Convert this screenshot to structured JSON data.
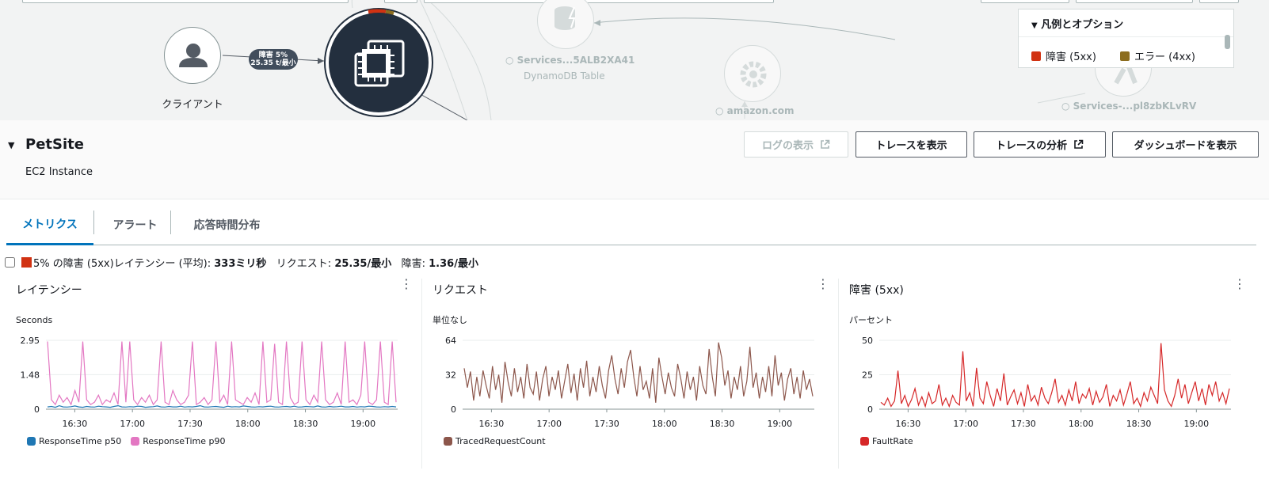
{
  "map": {
    "client_label": "クライアント",
    "edge_label_line1": "障害 5%",
    "edge_label_line2": "25.35 t/最小",
    "dynamo_name": "Services...5ALB2XA41",
    "dynamo_type": "DynamoDB Table",
    "amazon_name": "amazon.com",
    "lambda_name": "Services-...pl8zbKLvRV"
  },
  "legend": {
    "header": "凡例とオプション",
    "items": [
      {
        "label": "障害 (5xx)",
        "color": "#d13212"
      },
      {
        "label": "エラー (4xx)",
        "color": "#8c6d1f"
      }
    ]
  },
  "detail": {
    "title": "PetSite",
    "type": "EC2 Instance",
    "buttons": {
      "logs": "ログの表示",
      "traces": "トレースを表示",
      "analytics": "トレースの分析",
      "dashboard": "ダッシュボードを表示"
    }
  },
  "tabs": [
    "メトリクス",
    "アラート",
    "応答時間分布"
  ],
  "summary": {
    "fault_label": "5% の障害 (5xx)",
    "latency_label": "レイテンシー (平均):",
    "latency_value": "333ミリ秒",
    "requests_label": "リクエスト:",
    "requests_value": "25.35/最小",
    "faults_label": "障害:",
    "faults_value": "1.36/最小"
  },
  "colors": {
    "accent": "#0073bb",
    "fault": "#d13212",
    "error": "#8c6d1f",
    "p50": "#1f77b4",
    "p90": "#e377c2",
    "requests": "#8c564b",
    "faultrate": "#d62728"
  },
  "chart_data": [
    {
      "type": "line",
      "title": "レイテンシー",
      "ylabel": "Seconds",
      "yticks": [
        "2.95",
        "1.48",
        "0"
      ],
      "ylim": [
        0,
        2.95
      ],
      "xticks": [
        "16:30",
        "17:00",
        "17:30",
        "18:00",
        "18:30",
        "19:00"
      ],
      "xlim": [
        16.25,
        19.3
      ],
      "series": [
        {
          "name": "ResponseTime p50",
          "color": "#1f77b4",
          "values": [
            0.1,
            0.12,
            0.08,
            0.15,
            0.1,
            0.09,
            0.11,
            0.14,
            0.1,
            0.08,
            0.12,
            0.1,
            0.09,
            0.13,
            0.11,
            0.1,
            0.08,
            0.12,
            0.15,
            0.1,
            0.09,
            0.11,
            0.1,
            0.13,
            0.12,
            0.08,
            0.1,
            0.11,
            0.14,
            0.1,
            0.09,
            0.12,
            0.1,
            0.1,
            0.13,
            0.09,
            0.11,
            0.1,
            0.12,
            0.15,
            0.1,
            0.09,
            0.11,
            0.12,
            0.1,
            0.08,
            0.13,
            0.1,
            0.11,
            0.1,
            0.14,
            0.12,
            0.1,
            0.09,
            0.11,
            0.1,
            0.12,
            0.13,
            0.1,
            0.09,
            0.11,
            0.12,
            0.1,
            0.13,
            0.09,
            0.1,
            0.12,
            0.11,
            0.1,
            0.14,
            0.1,
            0.09,
            0.12,
            0.1,
            0.11,
            0.13,
            0.1,
            0.1,
            0.12,
            0.09,
            0.11,
            0.1,
            0.13,
            0.12,
            0.1,
            0.09,
            0.11,
            0.1,
            0.12,
            0.1
          ]
        },
        {
          "name": "ResponseTime p90",
          "color": "#e377c2",
          "values": [
            2.9,
            0.4,
            0.2,
            0.6,
            0.3,
            0.5,
            0.2,
            0.8,
            0.3,
            2.9,
            0.4,
            0.2,
            0.3,
            0.6,
            0.2,
            0.4,
            0.3,
            0.7,
            0.2,
            2.9,
            0.3,
            2.9,
            0.4,
            0.2,
            0.5,
            0.3,
            0.6,
            0.2,
            0.4,
            2.9,
            0.3,
            0.2,
            0.8,
            0.4,
            0.2,
            0.3,
            0.6,
            2.9,
            0.2,
            0.3,
            0.5,
            0.2,
            0.4,
            2.9,
            0.3,
            0.6,
            0.2,
            2.9,
            0.4,
            0.3,
            0.2,
            0.5,
            0.3,
            0.7,
            0.2,
            2.9,
            0.3,
            0.4,
            2.8,
            0.3,
            0.2,
            2.9,
            0.5,
            0.2,
            0.3,
            2.9,
            0.4,
            0.2,
            0.6,
            0.3,
            2.9,
            0.4,
            0.2,
            0.3,
            0.7,
            0.2,
            2.9,
            0.3,
            0.4,
            0.2,
            0.6,
            2.9,
            0.3,
            0.2,
            0.4,
            2.9,
            0.3,
            0.2,
            2.9,
            0.3
          ]
        }
      ]
    },
    {
      "type": "line",
      "title": "リクエスト",
      "ylabel": "単位なし",
      "yticks": [
        "64",
        "32",
        "0"
      ],
      "ylim": [
        0,
        64
      ],
      "xticks": [
        "16:30",
        "17:00",
        "17:30",
        "18:00",
        "18:30",
        "19:00"
      ],
      "xlim": [
        16.25,
        19.3
      ],
      "series": [
        {
          "name": "TracedRequestCount",
          "color": "#8c564b",
          "values": [
            38,
            20,
            35,
            8,
            30,
            12,
            36,
            22,
            10,
            40,
            18,
            32,
            6,
            44,
            25,
            12,
            38,
            16,
            30,
            10,
            42,
            20,
            14,
            35,
            8,
            28,
            40,
            12,
            30,
            18,
            36,
            10,
            26,
            42,
            15,
            33,
            8,
            38,
            20,
            45,
            12,
            30,
            16,
            40,
            22,
            10,
            36,
            50,
            28,
            14,
            38,
            20,
            44,
            55,
            30,
            12,
            40,
            18,
            26,
            10,
            38,
            6,
            48,
            30,
            14,
            34,
            20,
            12,
            42,
            28,
            10,
            35,
            18,
            30,
            8,
            40,
            22,
            14,
            56,
            30,
            12,
            62,
            48,
            22,
            36,
            10,
            30,
            18,
            40,
            12,
            26,
            58,
            20,
            34,
            10,
            30,
            16,
            40,
            12,
            50,
            22,
            34,
            8,
            28,
            38,
            14,
            30,
            10,
            36,
            18,
            28,
            12
          ]
        }
      ]
    },
    {
      "type": "line",
      "title": "障害 (5xx)",
      "ylabel": "パーセント",
      "yticks": [
        "50",
        "25",
        "0"
      ],
      "ylim": [
        0,
        50
      ],
      "xticks": [
        "16:30",
        "17:00",
        "17:30",
        "18:00",
        "18:30",
        "19:00"
      ],
      "xlim": [
        16.25,
        19.3
      ],
      "series": [
        {
          "name": "FaultRate",
          "color": "#d62728",
          "values": [
            5,
            3,
            8,
            2,
            6,
            28,
            4,
            10,
            2,
            7,
            15,
            3,
            9,
            2,
            12,
            4,
            6,
            18,
            3,
            8,
            2,
            10,
            5,
            3,
            42,
            6,
            12,
            2,
            30,
            8,
            4,
            20,
            10,
            2,
            15,
            6,
            26,
            3,
            9,
            14,
            4,
            12,
            2,
            18,
            6,
            10,
            3,
            16,
            8,
            4,
            12,
            22,
            5,
            10,
            3,
            14,
            6,
            20,
            4,
            11,
            8,
            15,
            3,
            13,
            5,
            9,
            18,
            2,
            10,
            6,
            14,
            3,
            11,
            20,
            4,
            8,
            2,
            12,
            6,
            16,
            10,
            4,
            48,
            14,
            6,
            2,
            10,
            22,
            8,
            18,
            4,
            12,
            20,
            6,
            15,
            3,
            18,
            10,
            20,
            6,
            12,
            4,
            15
          ]
        }
      ]
    }
  ]
}
